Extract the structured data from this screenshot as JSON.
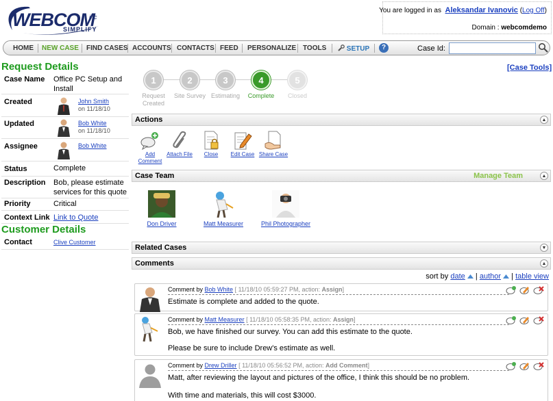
{
  "header": {
    "logo_text": "WEBCOM",
    "logo_inc": "inc",
    "logo_tag": "SIMPLIFY",
    "logged_in_prefix": "You are logged in as",
    "user_name": "Aleksandar Ivanovic",
    "logoff_label": "Log Off",
    "domain_label": "Domain :",
    "domain_value": "webcomdemo"
  },
  "nav": {
    "items": [
      "HOME",
      "NEW CASE",
      "FIND CASES",
      "ACCOUNTS",
      "CONTACTS",
      "FEED",
      "PERSONALIZE",
      "TOOLS",
      "SETUP"
    ],
    "help": "?",
    "case_id_label": "Case Id:",
    "case_id_value": ""
  },
  "request_details": {
    "title": "Request Details",
    "case_name_label": "Case Name",
    "case_name_value": "Office PC Setup and Install",
    "created_label": "Created",
    "created_by": "John Smith",
    "created_on": "on 11/18/10",
    "updated_label": "Updated",
    "updated_by": "Bob White",
    "updated_on": "on 11/18/10",
    "assignee_label": "Assignee",
    "assignee_name": "Bob White",
    "status_label": "Status",
    "status_value": "Complete",
    "description_label": "Description",
    "description_value": "Bob, please estimate services for this quote",
    "priority_label": "Priority",
    "priority_value": "Critical",
    "context_link_label": "Context Link",
    "context_link_value": "Link to Quote"
  },
  "customer_details": {
    "title": "Customer Details",
    "contact_label": "Contact",
    "contact_value": "Clive Customer"
  },
  "steps": [
    {
      "num": "1",
      "label": "Request Created",
      "state": "done"
    },
    {
      "num": "2",
      "label": "Site Survey",
      "state": "done"
    },
    {
      "num": "3",
      "label": "Estimating",
      "state": "done"
    },
    {
      "num": "4",
      "label": "Complete",
      "state": "current"
    },
    {
      "num": "5",
      "label": "Closed",
      "state": "future"
    }
  ],
  "case_tools": "[Case Tools]",
  "actions": {
    "title": "Actions",
    "items": [
      "Add Comment",
      "Attach File",
      "Close",
      "Edit Case",
      "Share Case"
    ]
  },
  "case_team": {
    "title": "Case Team",
    "manage": "Manage Team",
    "members": [
      "Don Driver",
      "Matt Measurer",
      "Phil Photographer"
    ]
  },
  "related_cases": {
    "title": "Related Cases"
  },
  "comments": {
    "title": "Comments",
    "sort_prefix": "sort by",
    "sort_date": "date",
    "sort_author": "author",
    "table_view": "table view",
    "sep": "|",
    "comment_by": "Comment by",
    "items": [
      {
        "author": "Bob White",
        "meta_pre": "[ 11/18/10 05:59:27 PM, action: ",
        "action": "Assign",
        "meta_post": "]",
        "lines": [
          "Estimate is complete and added to the quote."
        ]
      },
      {
        "author": "Matt Measurer",
        "meta_pre": "[ 11/18/10 05:58:35 PM, action: ",
        "action": "Assign",
        "meta_post": "]",
        "lines": [
          "Bob, we have finished our survey.  You can add this estimate to the quote.",
          "Please be sure to include Drew's estimate as well."
        ]
      },
      {
        "author": "Drew Driller",
        "meta_pre": "[ 11/18/10 05:56:52 PM, action: ",
        "action": "Add Comment",
        "meta_post": "]",
        "lines": [
          "Matt, after reviewing the layout and pictures of the office, I think this should be no problem.",
          "With time and materials, this will cost $3000."
        ]
      }
    ]
  },
  "colors": {
    "title_green": "#1e9b1e",
    "link_blue": "#1a3fbf",
    "step_current": "#3a9a2a"
  }
}
